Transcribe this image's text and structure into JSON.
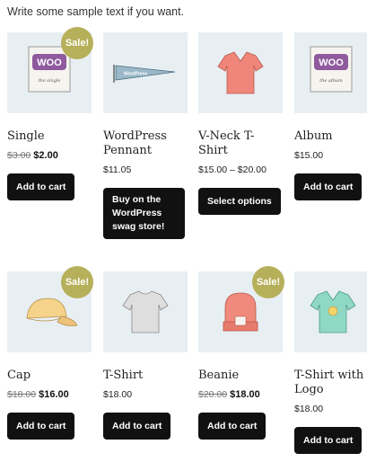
{
  "intro_text": "Write some sample text if you want.",
  "accent_sale_color": "#b6b05a",
  "products": [
    {
      "title": "Single",
      "sale_badge": "Sale!",
      "old_price": "$3.00",
      "price": "$2.00",
      "button": "Add to cart",
      "image_icon": "woo-album-icon",
      "image_caption": "the single"
    },
    {
      "title": "WordPress Pennant",
      "price": "$11.05",
      "button": "Buy on the WordPress swag store!",
      "image_icon": "pennant-icon",
      "image_caption": "WordPress"
    },
    {
      "title": "V-Neck T-Shirt",
      "price": "$15.00 – $20.00",
      "button": "Select options",
      "image_icon": "vneck-shirt-icon"
    },
    {
      "title": "Album",
      "price": "$15.00",
      "button": "Add to cart",
      "image_icon": "woo-album-icon",
      "image_caption": "the album"
    },
    {
      "title": "Cap",
      "sale_badge": "Sale!",
      "old_price": "$18.00",
      "price": "$16.00",
      "button": "Add to cart",
      "image_icon": "cap-icon"
    },
    {
      "title": "T-Shirt",
      "price": "$18.00",
      "button": "Add to cart",
      "image_icon": "tshirt-icon"
    },
    {
      "title": "Beanie",
      "sale_badge": "Sale!",
      "old_price": "$20.00",
      "price": "$18.00",
      "button": "Add to cart",
      "image_icon": "beanie-icon"
    },
    {
      "title": "T-Shirt with Logo",
      "price": "$18.00",
      "button": "Add to cart",
      "image_icon": "logo-shirt-icon"
    }
  ],
  "woo_logo_text": "WOO"
}
